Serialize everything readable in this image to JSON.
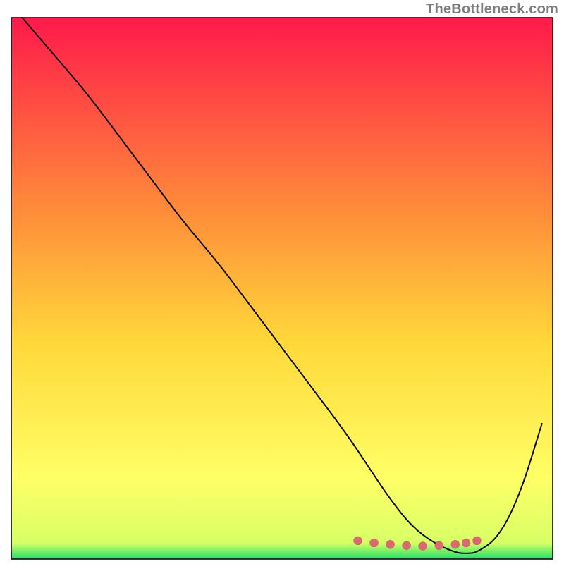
{
  "watermark": "TheBottleneck.com",
  "colors": {
    "gradient_top": "#ff1a4b",
    "gradient_upper_mid": "#ff8a3a",
    "gradient_mid": "#ffd83a",
    "gradient_lower_mid": "#ffff66",
    "gradient_bottom": "#1fe06a",
    "curve": "#0a0a0a",
    "marker": "#d96a6f",
    "border": "#0a0a0a"
  },
  "chart_data": {
    "type": "line",
    "title": "",
    "xlabel": "",
    "ylabel": "",
    "xlim": [
      0,
      100
    ],
    "ylim": [
      0,
      100
    ],
    "grid": false,
    "legend": false,
    "annotations": [],
    "series": [
      {
        "name": "bottleneck-curve",
        "x": [
          2,
          8,
          14,
          20,
          26,
          32,
          38,
          44,
          50,
          56,
          62,
          66,
          70,
          74,
          78,
          82,
          84,
          86,
          90,
          94,
          98
        ],
        "y": [
          100,
          93,
          86,
          78,
          70,
          62,
          55,
          47,
          39,
          31,
          23,
          17,
          11,
          6,
          3,
          1.2,
          1,
          1.2,
          4,
          12,
          25
        ]
      }
    ],
    "markers": {
      "name": "optimal-band",
      "x": [
        64,
        67,
        70,
        73,
        76,
        79,
        82,
        84,
        86
      ],
      "y": [
        3.4,
        3.0,
        2.7,
        2.5,
        2.4,
        2.5,
        2.7,
        3.0,
        3.4
      ]
    },
    "gradient_stops": [
      {
        "offset": 0,
        "color": "#ff1a4b"
      },
      {
        "offset": 35,
        "color": "#ff8a3a"
      },
      {
        "offset": 60,
        "color": "#ffd83a"
      },
      {
        "offset": 85,
        "color": "#ffff66"
      },
      {
        "offset": 97,
        "color": "#d8ff66"
      },
      {
        "offset": 100,
        "color": "#1fe06a"
      }
    ]
  }
}
